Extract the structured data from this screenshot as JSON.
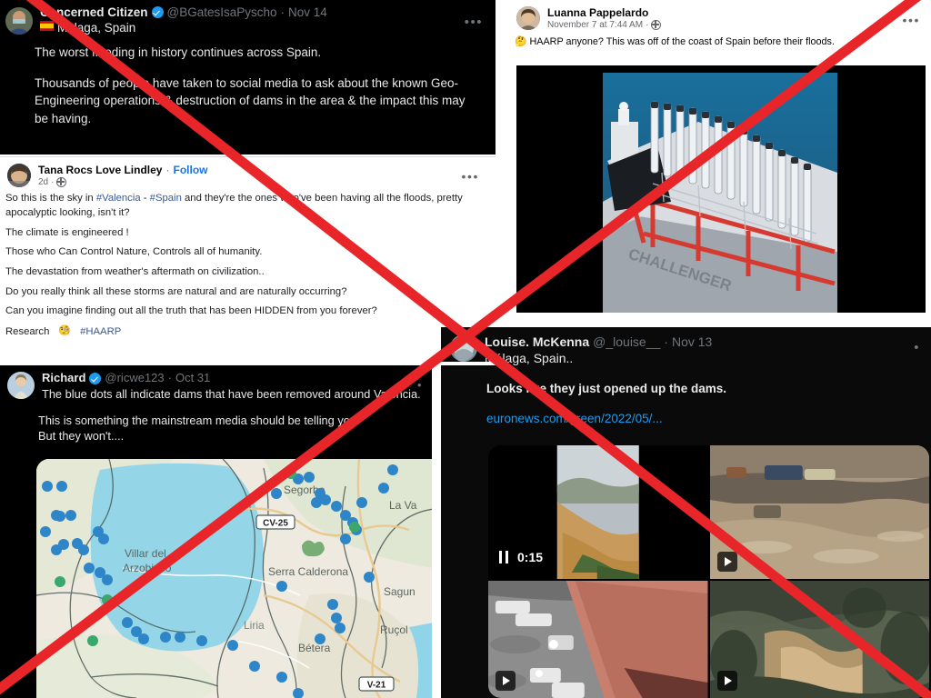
{
  "overlay": {
    "mark": "red-x-debunk-cross",
    "color": "#e8262a"
  },
  "panels": {
    "concerned_citizen": {
      "platform": "twitter",
      "display_name": "Concerned Citizen",
      "verified": true,
      "handle": "@BGatesIsaPyscho",
      "separator": "·",
      "date": "Nov 14",
      "location_flag": "🇪🇸",
      "location": "Malaga, Spain",
      "more_label": "•••",
      "body": [
        "The worst flooding in history continues across Spain.",
        "Thousands of people have taken to social media to ask about the known Geo-Engineering operations & destruction of dams in the area & the impact this may be having."
      ]
    },
    "tana_rocs": {
      "platform": "facebook",
      "display_name": "Tana Rocs Love Lindley",
      "separator": "·",
      "follow_label": "Follow",
      "time_ago": "2d",
      "audience_icon": "globe-icon",
      "more_label": "•••",
      "body_lines": [
        "So this is the sky in #Valencia - #Spain and they're the ones who've been having all the floods, pretty apocalyptic looking, isn't it?",
        "The climate is engineered !",
        "Those who Can Control Nature, Controls all of humanity.",
        "The devastation from weather's aftermath on civilization..",
        "Do you really think all these storms are natural and are naturally occurring?",
        "Can you imagine finding out all the truth that has been HIDDEN from you forever?"
      ],
      "footer": {
        "text": "Research",
        "emoji": "🧐",
        "hashtag": "#HAARP"
      },
      "hashtags": [
        "#Valencia",
        "#Spain",
        "#HAARP"
      ]
    },
    "richard": {
      "platform": "twitter",
      "display_name": "Richard",
      "verified": true,
      "handle": "@ricwe123",
      "separator": "·",
      "date": "Oct 31",
      "more_label": "•",
      "first_line": "The blue dots all indicate dams that have been removed around Valencia.",
      "body": [
        "This is something the mainstream media should be telling you.",
        "But they won't...."
      ],
      "map": {
        "type": "street-map",
        "place_labels": [
          "Segorbe",
          "La Va",
          "Villar del Arzobispo",
          "Serra Calderona",
          "Sagun",
          "Liria",
          "Ruçol",
          "Bétera"
        ],
        "road_shields": [
          "CV-25",
          "V-21"
        ],
        "marker_legend": "blue dots = dams removed",
        "marker_color_blue": "#2e86c8",
        "marker_color_green": "#3aa76d"
      }
    },
    "luanna": {
      "platform": "facebook",
      "display_name": "Luanna Pappelardo",
      "timestamp": "November 7 at 7:44 AM",
      "separator": "·",
      "audience_icon": "globe-icon",
      "more_label": "•••",
      "body_emoji": "🤔",
      "body": "HAARP anyone? This was off of the coast of Spain before their floods.",
      "image_alt": "ship-with-row-of-exhaust-stacks-at-sea"
    },
    "louise": {
      "platform": "twitter",
      "display_name": "Louise. McKenna",
      "handle": "@_louise__",
      "separator": "·",
      "date": "Nov 13",
      "subtitle": "Málaga, Spain..",
      "more_label": "•",
      "body": "Looks like they just opened up the dams.",
      "url": "euronews.com/green/2022/05/...",
      "videos": [
        {
          "position": "top-left",
          "state": "paused",
          "duration": "0:15",
          "control_icon": "pause-icon",
          "alt": "muddy-flood-surge-in-valley"
        },
        {
          "position": "top-right",
          "state": "play",
          "control_icon": "play-icon",
          "alt": "brown-floodwater-over-farmland"
        },
        {
          "position": "bottom-left",
          "state": "play",
          "control_icon": "play-icon",
          "alt": "flooded-street-with-cars"
        },
        {
          "position": "bottom-right",
          "state": "play",
          "control_icon": "play-icon",
          "alt": "water-torrent-through-trees"
        }
      ]
    }
  }
}
